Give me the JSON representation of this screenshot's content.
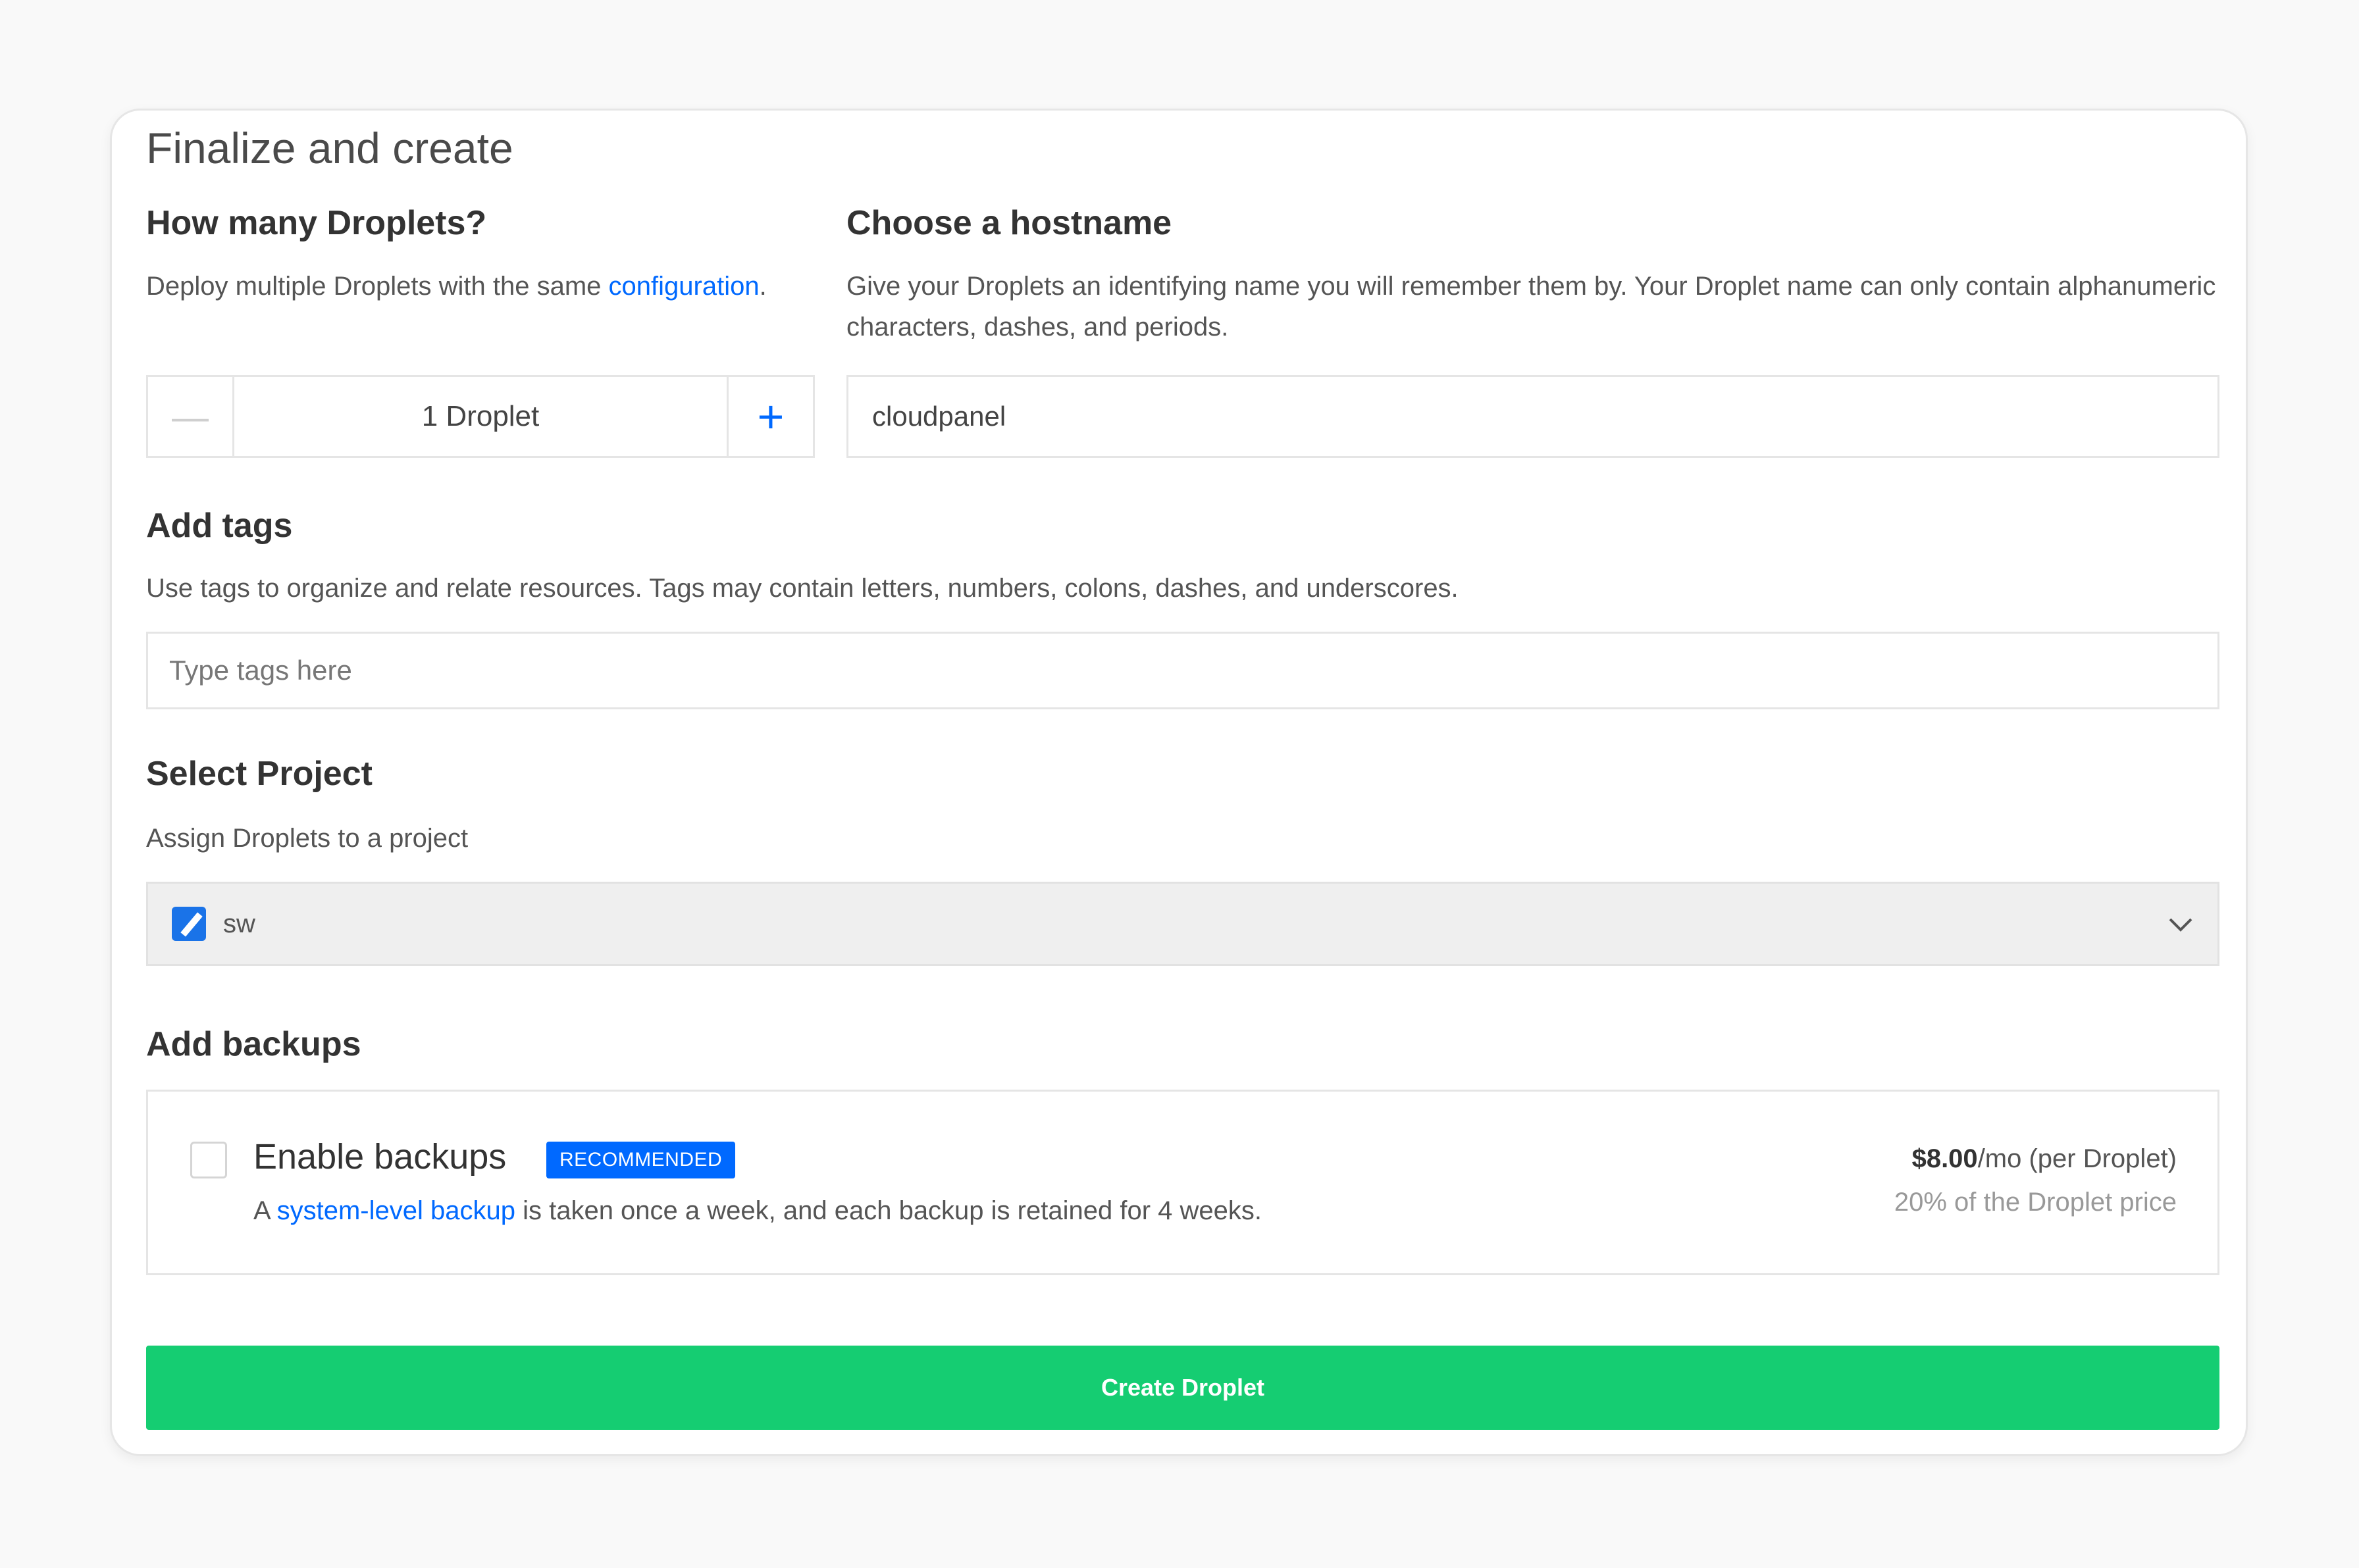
{
  "page": {
    "title": "Finalize and create"
  },
  "droplets": {
    "heading": "How many Droplets?",
    "desc_prefix": "Deploy multiple Droplets with the same ",
    "desc_link": "configuration",
    "desc_suffix": ".",
    "minus": "—",
    "plus": "+",
    "count_value": "1  Droplet"
  },
  "hostname": {
    "heading": "Choose a hostname",
    "desc": "Give your Droplets an identifying name you will remember them by. Your Droplet name can only contain alphanumeric characters, dashes, and periods.",
    "value": "cloudpanel"
  },
  "tags": {
    "heading": "Add tags",
    "desc": "Use tags to organize and relate resources. Tags may contain letters, numbers, colons, dashes, and underscores.",
    "placeholder": "Type tags here"
  },
  "project": {
    "heading": "Select Project",
    "desc": "Assign Droplets to a project",
    "selected": "sw"
  },
  "backups": {
    "heading": "Add backups",
    "option_label": "Enable backups",
    "badge": "RECOMMENDED",
    "desc_prefix": "A ",
    "desc_link": "system-level backup",
    "desc_suffix": " is taken once a week, and each backup is retained for 4 weeks.",
    "price_amount": "$8.00",
    "price_suffix": "/mo (per Droplet)",
    "price_note": "20% of the Droplet price"
  },
  "create_button": "Create Droplet",
  "colors": {
    "link": "#0069ff",
    "primary_button": "#15cd72",
    "badge": "#0069ff"
  }
}
